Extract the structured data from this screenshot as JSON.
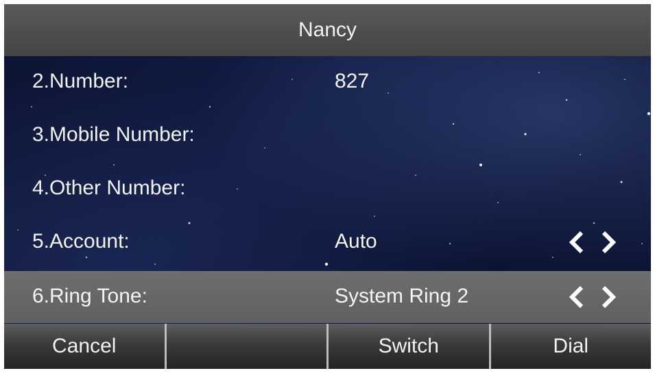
{
  "title": "Nancy",
  "rows": [
    {
      "label": "2.Number:",
      "value": "827",
      "has_arrows": false
    },
    {
      "label": "3.Mobile Number:",
      "value": "",
      "has_arrows": false
    },
    {
      "label": "4.Other Number:",
      "value": "",
      "has_arrows": false
    },
    {
      "label": "5.Account:",
      "value": "Auto",
      "has_arrows": true
    },
    {
      "label": "6.Ring Tone:",
      "value": "System Ring 2",
      "has_arrows": true,
      "selected": true
    }
  ],
  "softkeys": [
    "Cancel",
    "",
    "Switch",
    "Dial"
  ],
  "icons": {
    "left": "chevron-left-icon",
    "right": "chevron-right-icon"
  },
  "colors": {
    "title_bar": "#4e4e4e",
    "selected_row": "#65676a",
    "background": "#0f1a3e"
  }
}
